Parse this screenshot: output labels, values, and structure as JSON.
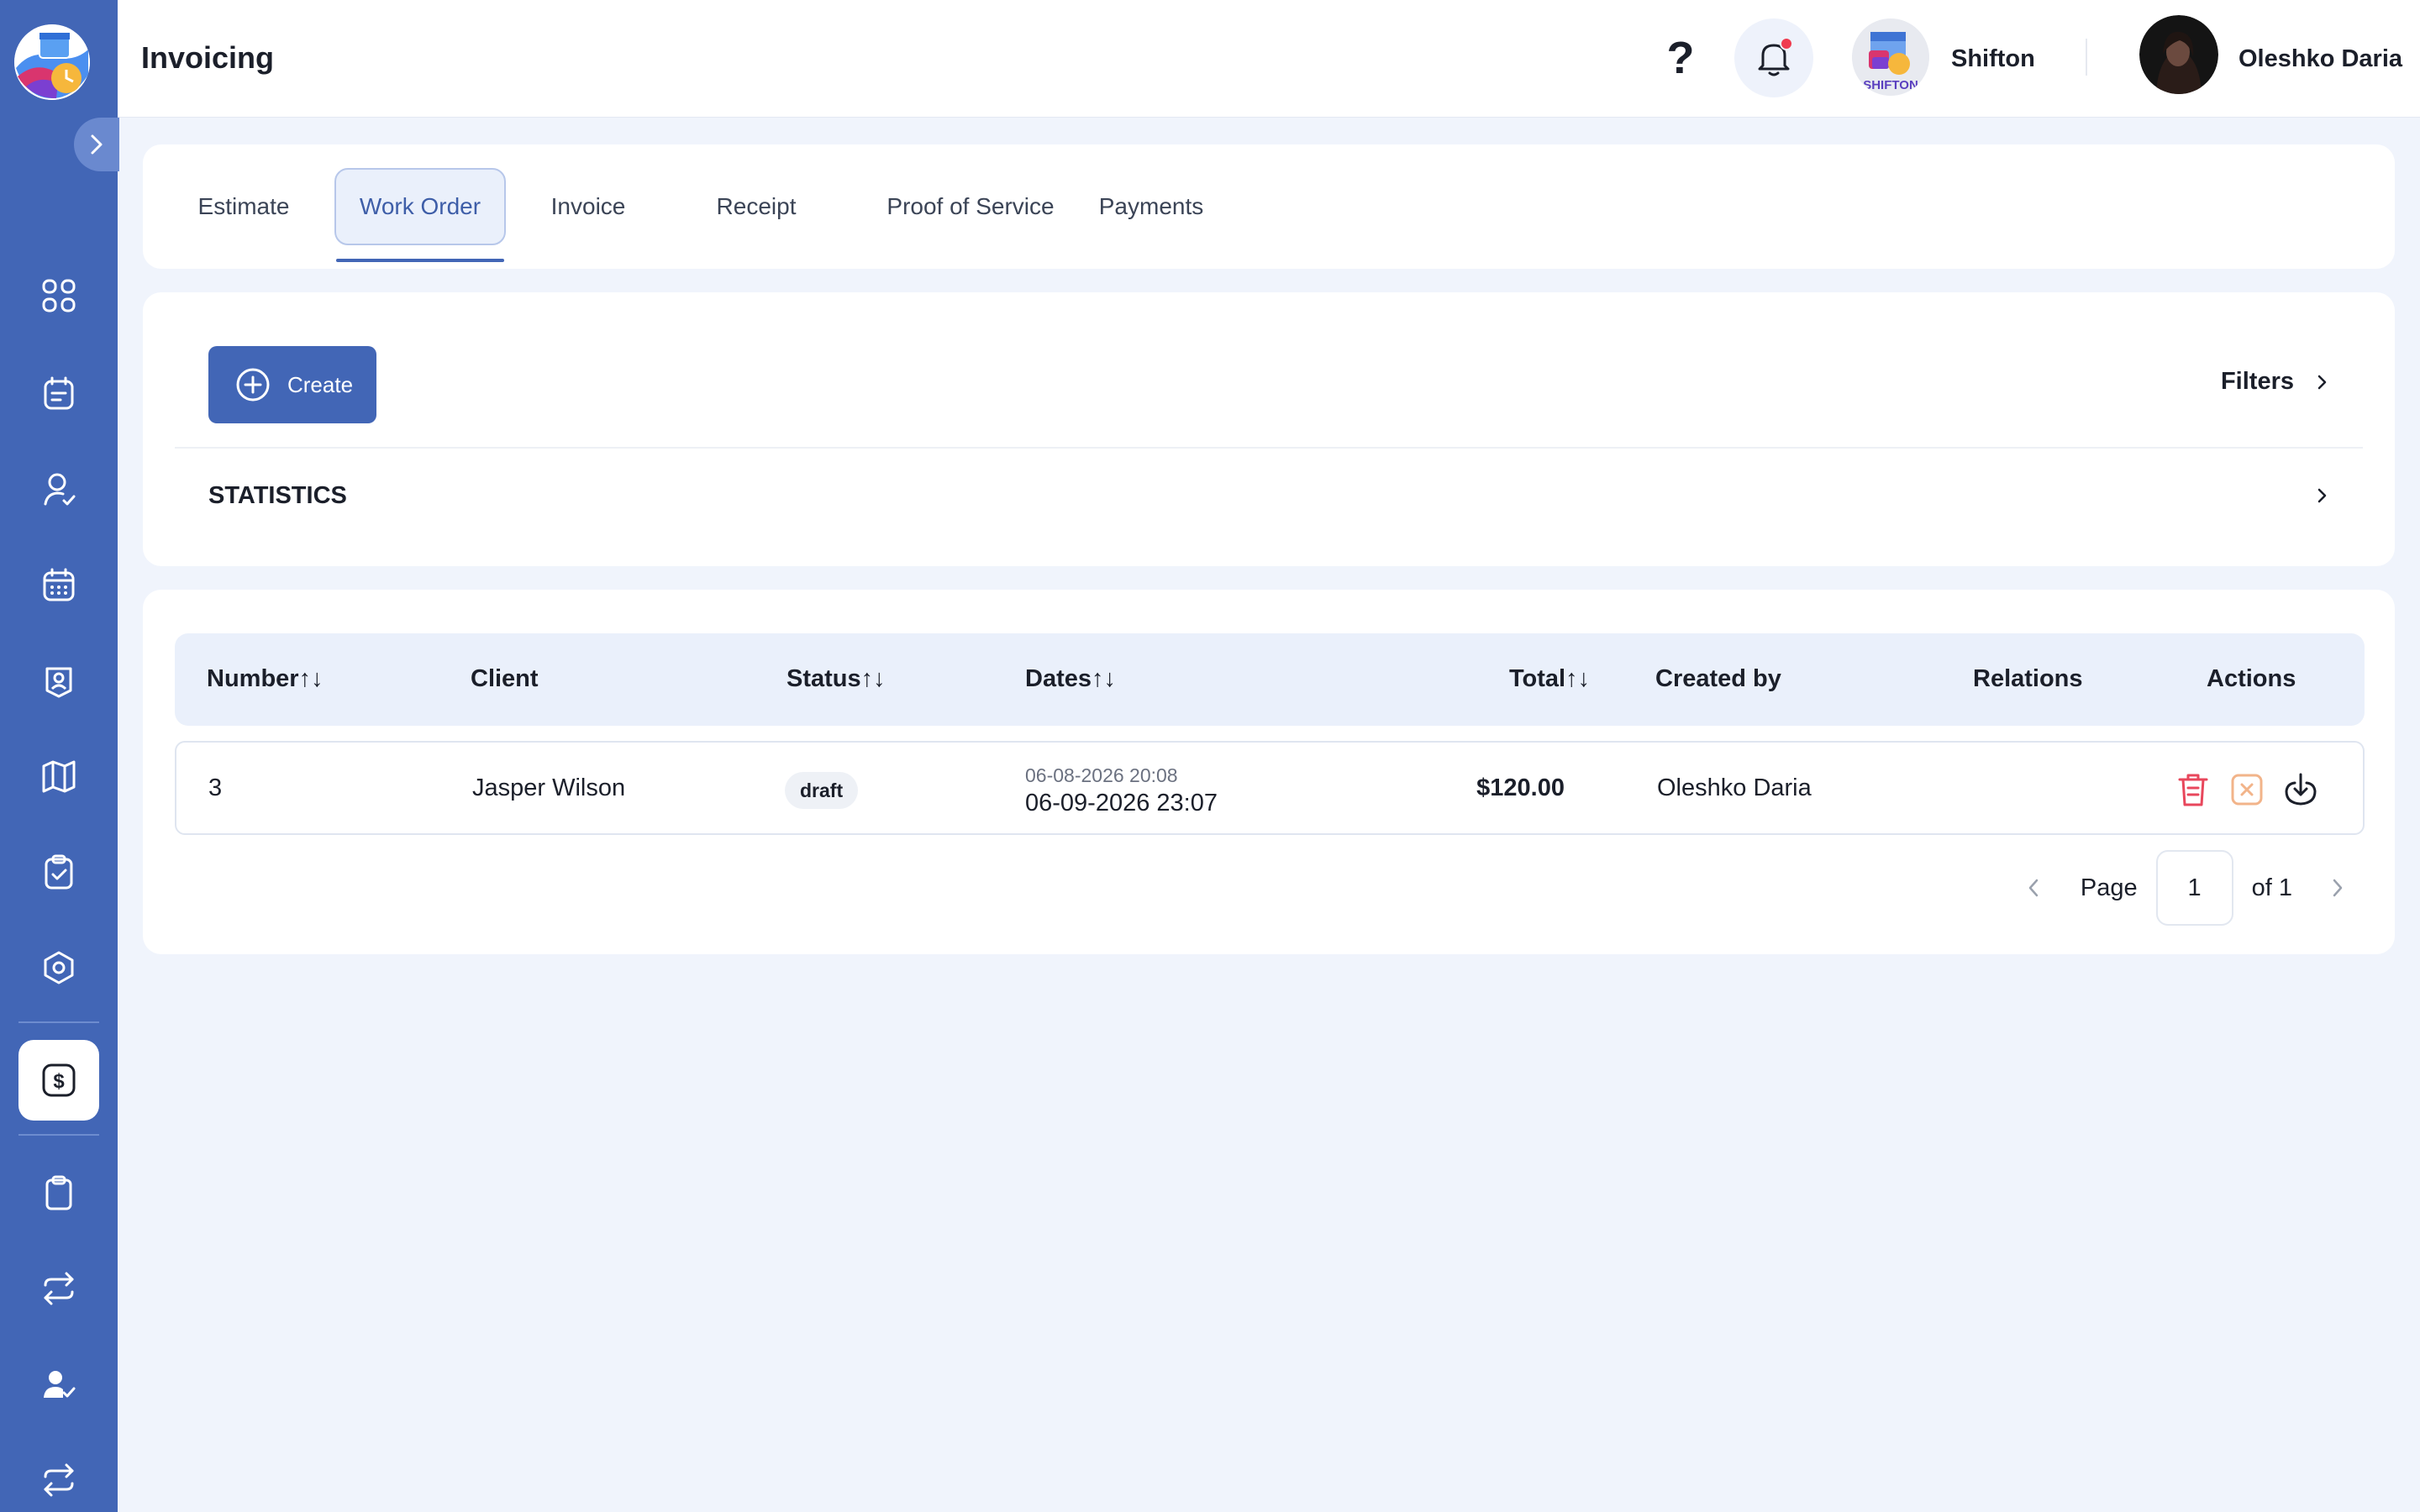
{
  "app": {
    "page_title": "Invoicing"
  },
  "header": {
    "help_label": "?",
    "company_name": "Shifton",
    "company_logo_text": "SHIFTON",
    "user_name": "Oleshko Daria"
  },
  "sidebar": {
    "items": [
      {
        "name": "dashboard",
        "icon": "grid-icon"
      },
      {
        "name": "tasks",
        "icon": "notes-icon"
      },
      {
        "name": "employees",
        "icon": "user-check-icon"
      },
      {
        "name": "schedule",
        "icon": "calendar-icon"
      },
      {
        "name": "badges",
        "icon": "id-badge-icon"
      },
      {
        "name": "map",
        "icon": "map-icon"
      },
      {
        "name": "checklists",
        "icon": "clipboard-check-icon"
      },
      {
        "name": "settings",
        "icon": "hexagon-settings-icon"
      },
      {
        "name": "invoicing",
        "icon": "dollar-square-icon",
        "active": true
      },
      {
        "name": "reports",
        "icon": "clipboard-icon"
      },
      {
        "name": "exchange",
        "icon": "repeat-icon"
      },
      {
        "name": "approvals",
        "icon": "user-approve-icon"
      },
      {
        "name": "sync",
        "icon": "repeat-icon"
      }
    ]
  },
  "tabs": [
    {
      "label": "Estimate",
      "active": false
    },
    {
      "label": "Work Order",
      "active": true
    },
    {
      "label": "Invoice",
      "active": false
    },
    {
      "label": "Receipt",
      "active": false
    },
    {
      "label": "Proof of Service",
      "active": false
    },
    {
      "label": "Payments",
      "active": false
    }
  ],
  "toolbar": {
    "create_label": "Create",
    "filters_label": "Filters",
    "statistics_label": "STATISTICS"
  },
  "table": {
    "columns": [
      {
        "label": "Number",
        "sort": "↑↓"
      },
      {
        "label": "Client",
        "sort": ""
      },
      {
        "label": "Status",
        "sort": "↑↓"
      },
      {
        "label": "Dates",
        "sort": "↑↓"
      },
      {
        "label": "Total",
        "sort": "↑↓"
      },
      {
        "label": "Created by",
        "sort": ""
      },
      {
        "label": "Relations",
        "sort": ""
      },
      {
        "label": "Actions",
        "sort": ""
      }
    ],
    "rows": [
      {
        "number": "3",
        "client": "Jasper Wilson",
        "status": "draft",
        "date_start": "06-08-2026 20:08",
        "date_end": "06-09-2026 23:07",
        "total": "$120.00",
        "created_by": "Oleshko Daria",
        "relations": ""
      }
    ]
  },
  "pagination": {
    "page_label": "Page",
    "current_page": "1",
    "of_label": "of 1"
  },
  "colors": {
    "sidebar": "#4266b6",
    "accent": "#4266b6",
    "background": "#f0f4fc",
    "delete": "#e8475c",
    "cancel": "#f2b48a",
    "notification_dot": "#ef3b4f"
  }
}
